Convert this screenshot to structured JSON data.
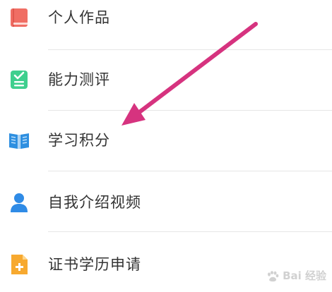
{
  "menu": {
    "items": [
      {
        "label": "个人作品",
        "icon": "red-book-icon"
      },
      {
        "label": "能力测评",
        "icon": "green-checklist-icon"
      },
      {
        "label": "学习积分",
        "icon": "blue-open-book-icon"
      },
      {
        "label": "自我介绍视频",
        "icon": "blue-person-icon"
      },
      {
        "label": "证书学历申请",
        "icon": "orange-document-plus-icon"
      }
    ]
  },
  "colors": {
    "arrow": "#d6337f",
    "book_red": "#f06e64",
    "check_green": "#3fcf8e",
    "book_blue": "#2e8fe0",
    "person_blue": "#2f8be6",
    "doc_orange": "#f7a92f"
  },
  "watermark": {
    "text": "Bai 经验"
  }
}
